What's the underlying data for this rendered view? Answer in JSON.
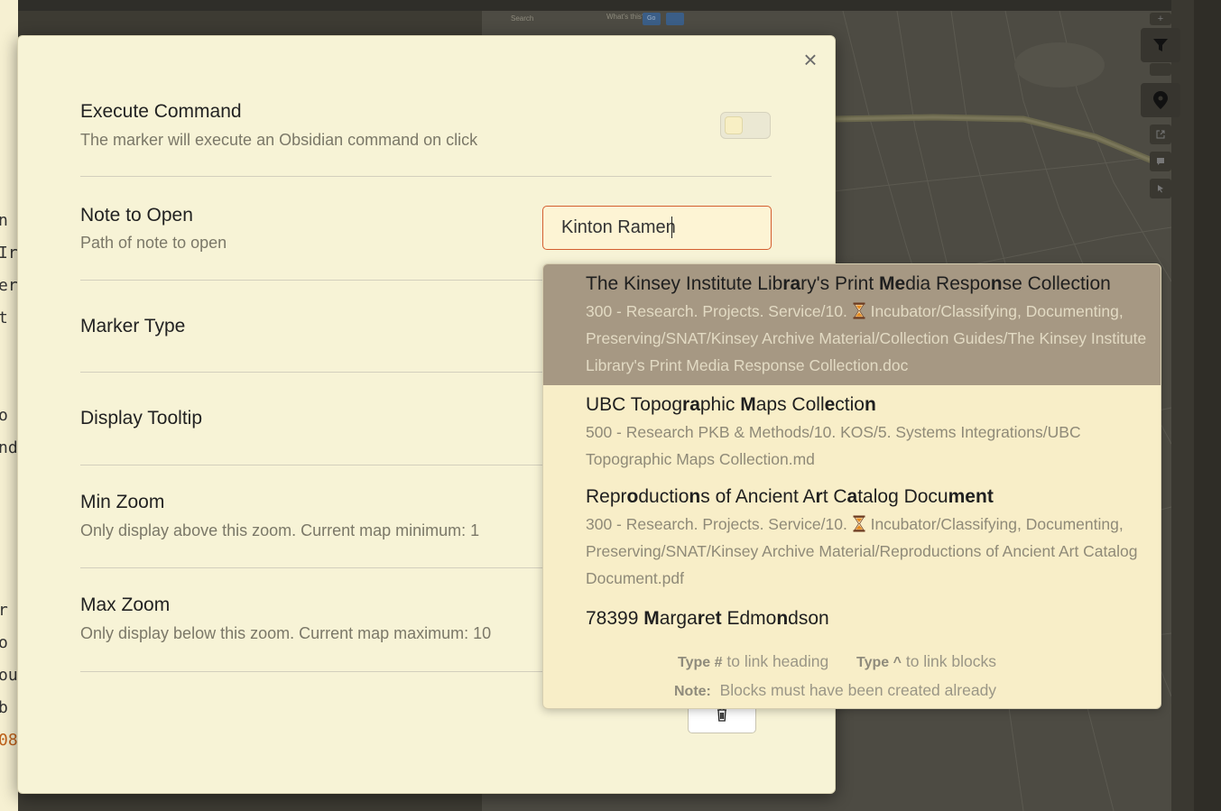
{
  "backdrop": {
    "map_search_placeholder": "Search",
    "map_search_hint": "What's this?",
    "map_go": "Go"
  },
  "modal": {
    "close_label": "×",
    "settings": [
      {
        "name": "Execute Command",
        "desc": "The marker will execute an Obsidian command on click"
      },
      {
        "name": "Note to Open",
        "desc": "Path of note to open"
      },
      {
        "name": "Marker Type",
        "desc": ""
      },
      {
        "name": "Display Tooltip",
        "desc": ""
      },
      {
        "name": "Min Zoom",
        "desc": "Only display above this zoom. Current map minimum: 1"
      },
      {
        "name": "Max Zoom",
        "desc": "Only display below this zoom. Current map maximum: 10"
      }
    ],
    "execute_command_enabled": false,
    "note_input_value": "Kinton Ramen"
  },
  "suggestions": {
    "items": [
      {
        "title_parts": [
          [
            "The Kinsey Institute Lib",
            false
          ],
          [
            "ra",
            true
          ],
          [
            "ry's Print ",
            false
          ],
          [
            "Me",
            true
          ],
          [
            "dia Respo",
            false
          ],
          [
            "n",
            true
          ],
          [
            "se Collection",
            false
          ]
        ],
        "path_before": "300 - Research. Projects. Service/10. ",
        "path_after": " Incubator/Classifying, Documenting, Preserving/SNAT/Kinsey Archive Material/Collection Guides/The Kinsey Institute Library's Print Media Response Collection.doc",
        "hourglass": true,
        "selected": true
      },
      {
        "title_parts": [
          [
            "UBC Topog",
            false
          ],
          [
            "ra",
            true
          ],
          [
            "phic ",
            false
          ],
          [
            "M",
            true
          ],
          [
            "aps Coll",
            false
          ],
          [
            "e",
            true
          ],
          [
            "ctio",
            false
          ],
          [
            "n",
            true
          ]
        ],
        "path_before": "500 - Research PKB & Methods/10. KOS/5. Systems Integrations/UBC Topographic Maps Collection.md",
        "path_after": "",
        "hourglass": false,
        "selected": false
      },
      {
        "title_parts": [
          [
            "Repr",
            false
          ],
          [
            "o",
            true
          ],
          [
            "ductio",
            false
          ],
          [
            "n",
            true
          ],
          [
            "s of Ancient A",
            false
          ],
          [
            "r",
            true
          ],
          [
            "t C",
            false
          ],
          [
            "a",
            true
          ],
          [
            "talog Docu",
            false
          ],
          [
            "men",
            true
          ],
          [
            "t",
            true
          ]
        ],
        "path_before": "300 - Research. Projects. Service/10. ",
        "path_after": " Incubator/Classifying, Documenting, Preserving/SNAT/Kinsey Archive Material/Reproductions of Ancient Art Catalog Document.pdf",
        "hourglass": true,
        "selected": false
      },
      {
        "title_parts": [
          [
            "78399 ",
            false
          ],
          [
            "M",
            true
          ],
          [
            "arga",
            false
          ],
          [
            "r",
            true
          ],
          [
            "e",
            false
          ],
          [
            "t",
            true
          ],
          [
            " Edmo",
            false
          ],
          [
            "n",
            true
          ],
          [
            "dson",
            false
          ]
        ],
        "path_before": "",
        "path_after": "",
        "hourglass": false,
        "selected": false
      }
    ],
    "instructions": {
      "heading_key": "Type #",
      "heading_text": "to link heading",
      "blocks_key": "Type ^",
      "blocks_text": "to link blocks",
      "note_key": "Note:",
      "note_text": "Blocks must have been created already"
    }
  }
}
